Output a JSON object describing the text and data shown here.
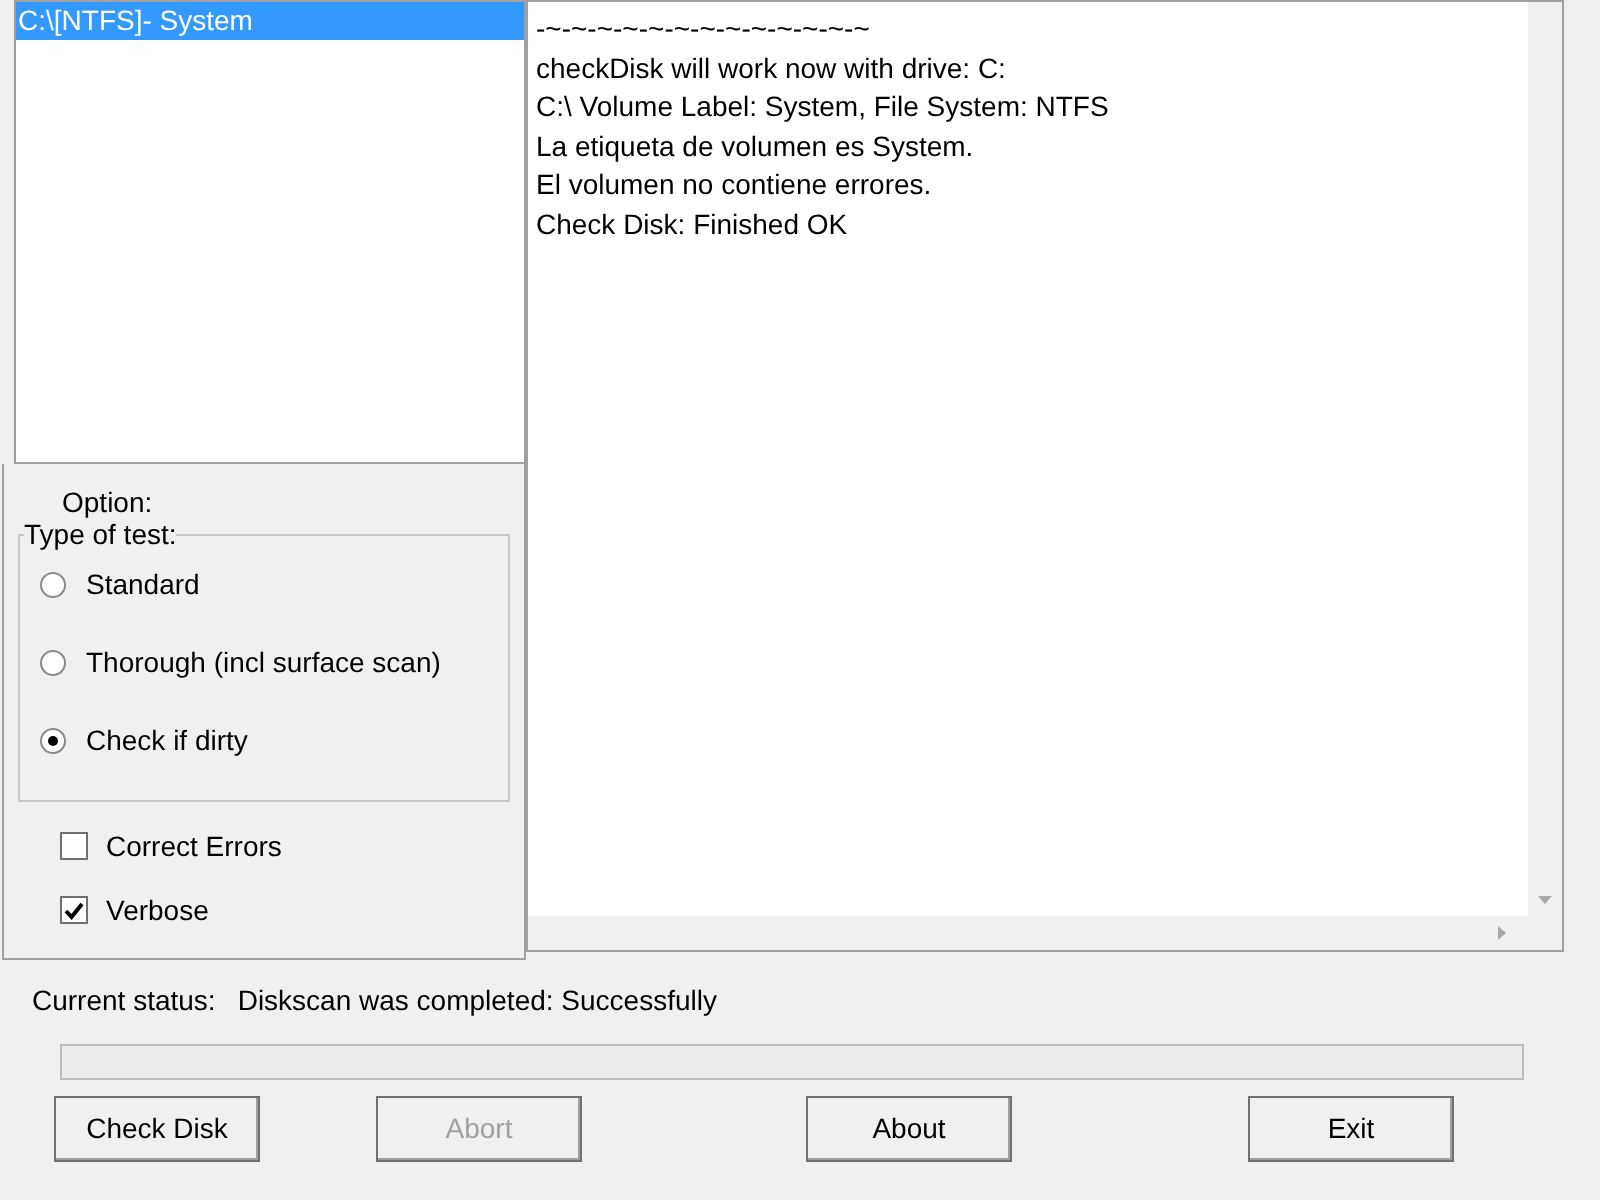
{
  "drives": [
    {
      "label": "C:\\[NTFS]- System",
      "selected": true
    }
  ],
  "log": [
    "-~-~-~-~-~-~-~-~-~-~-~-~-~",
    "checkDisk will work now with drive: C:",
    "C:\\ Volume Label: System, File System: NTFS",
    "La etiqueta de volumen es System.",
    "El volumen no contiene errores.",
    "Check Disk: Finished OK"
  ],
  "options": {
    "title": "Option:",
    "group_title": "Type of test:",
    "tests": [
      {
        "label": "Standard",
        "selected": false
      },
      {
        "label": "Thorough (incl surface scan)",
        "selected": false
      },
      {
        "label": "Check if dirty",
        "selected": true
      }
    ],
    "checkboxes": [
      {
        "label": "Correct Errors",
        "checked": false
      },
      {
        "label": "Verbose",
        "checked": true
      }
    ]
  },
  "status": {
    "label": "Current status:",
    "value": "Diskscan was completed: Successfully"
  },
  "progress": {
    "level": 0
  },
  "buttons": [
    {
      "label": "Check Disk",
      "disabled": false
    },
    {
      "label": "Abort",
      "disabled": true
    },
    {
      "label": "About",
      "disabled": false
    },
    {
      "label": "Exit",
      "disabled": false
    }
  ]
}
